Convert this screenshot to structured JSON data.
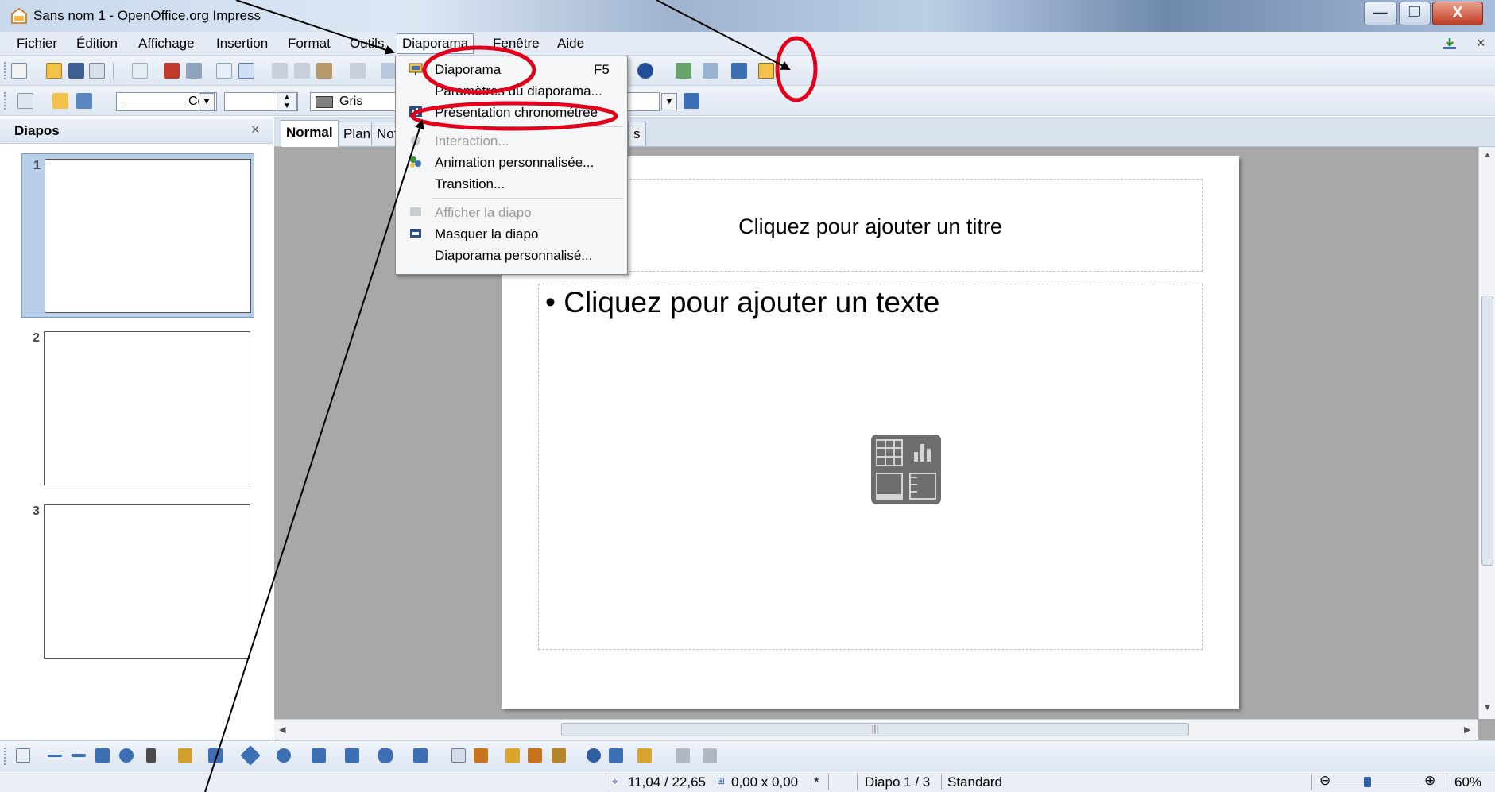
{
  "window": {
    "title": "Sans nom 1 - OpenOffice.org Impress",
    "min_glyph": "—",
    "max_glyph": "❐",
    "close_glyph": "X"
  },
  "menu": {
    "items": [
      "Fichier",
      "Édition",
      "Affichage",
      "Insertion",
      "Format",
      "Outils",
      "Diaporama",
      "Fenêtre",
      "Aide"
    ],
    "close_glyph": "×"
  },
  "toolbar2": {
    "line_label": "Co",
    "color_label": "Gris"
  },
  "slides_pane": {
    "title": "Diapos",
    "close_glyph": "×",
    "thumbnails": [
      "1",
      "2",
      "3"
    ]
  },
  "view_tabs": [
    "Normal",
    "Plan",
    "Not",
    "s"
  ],
  "slide": {
    "title_placeholder": "Cliquez pour ajouter un titre",
    "body_placeholder": "• Cliquez pour ajouter un texte"
  },
  "dropdown": {
    "items": [
      {
        "label": "Diaporama",
        "accel": "F5",
        "disabled": false,
        "icon": "slideshow-icon"
      },
      {
        "label": "Paramètres du diaporama...",
        "accel": "",
        "disabled": false,
        "icon": ""
      },
      {
        "label": "Présentation chronométrée",
        "accel": "",
        "disabled": false,
        "icon": "rehearse-timings-icon"
      },
      {
        "label": "Interaction...",
        "accel": "",
        "disabled": true,
        "icon": "interaction-icon"
      },
      {
        "label": "Animation personnalisée...",
        "accel": "",
        "disabled": false,
        "icon": "custom-animation-icon"
      },
      {
        "label": "Transition...",
        "accel": "",
        "disabled": false,
        "icon": ""
      },
      {
        "label": "Afficher la diapo",
        "accel": "",
        "disabled": true,
        "icon": "show-slide-icon"
      },
      {
        "label": "Masquer la diapo",
        "accel": "",
        "disabled": false,
        "icon": "hide-slide-icon"
      },
      {
        "label": "Diaporama personnalisé...",
        "accel": "",
        "disabled": false,
        "icon": ""
      }
    ]
  },
  "statusbar": {
    "position": "11,04 / 22,65",
    "size": "0,00 x 0,00",
    "modified": "*",
    "slide_info": "Diapo 1 / 3",
    "layout": "Standard",
    "zoom": "60%"
  },
  "colors": {
    "annotation": "#e3001b",
    "selection": "#b9cfe9",
    "workspace": "#a8a8a8"
  }
}
